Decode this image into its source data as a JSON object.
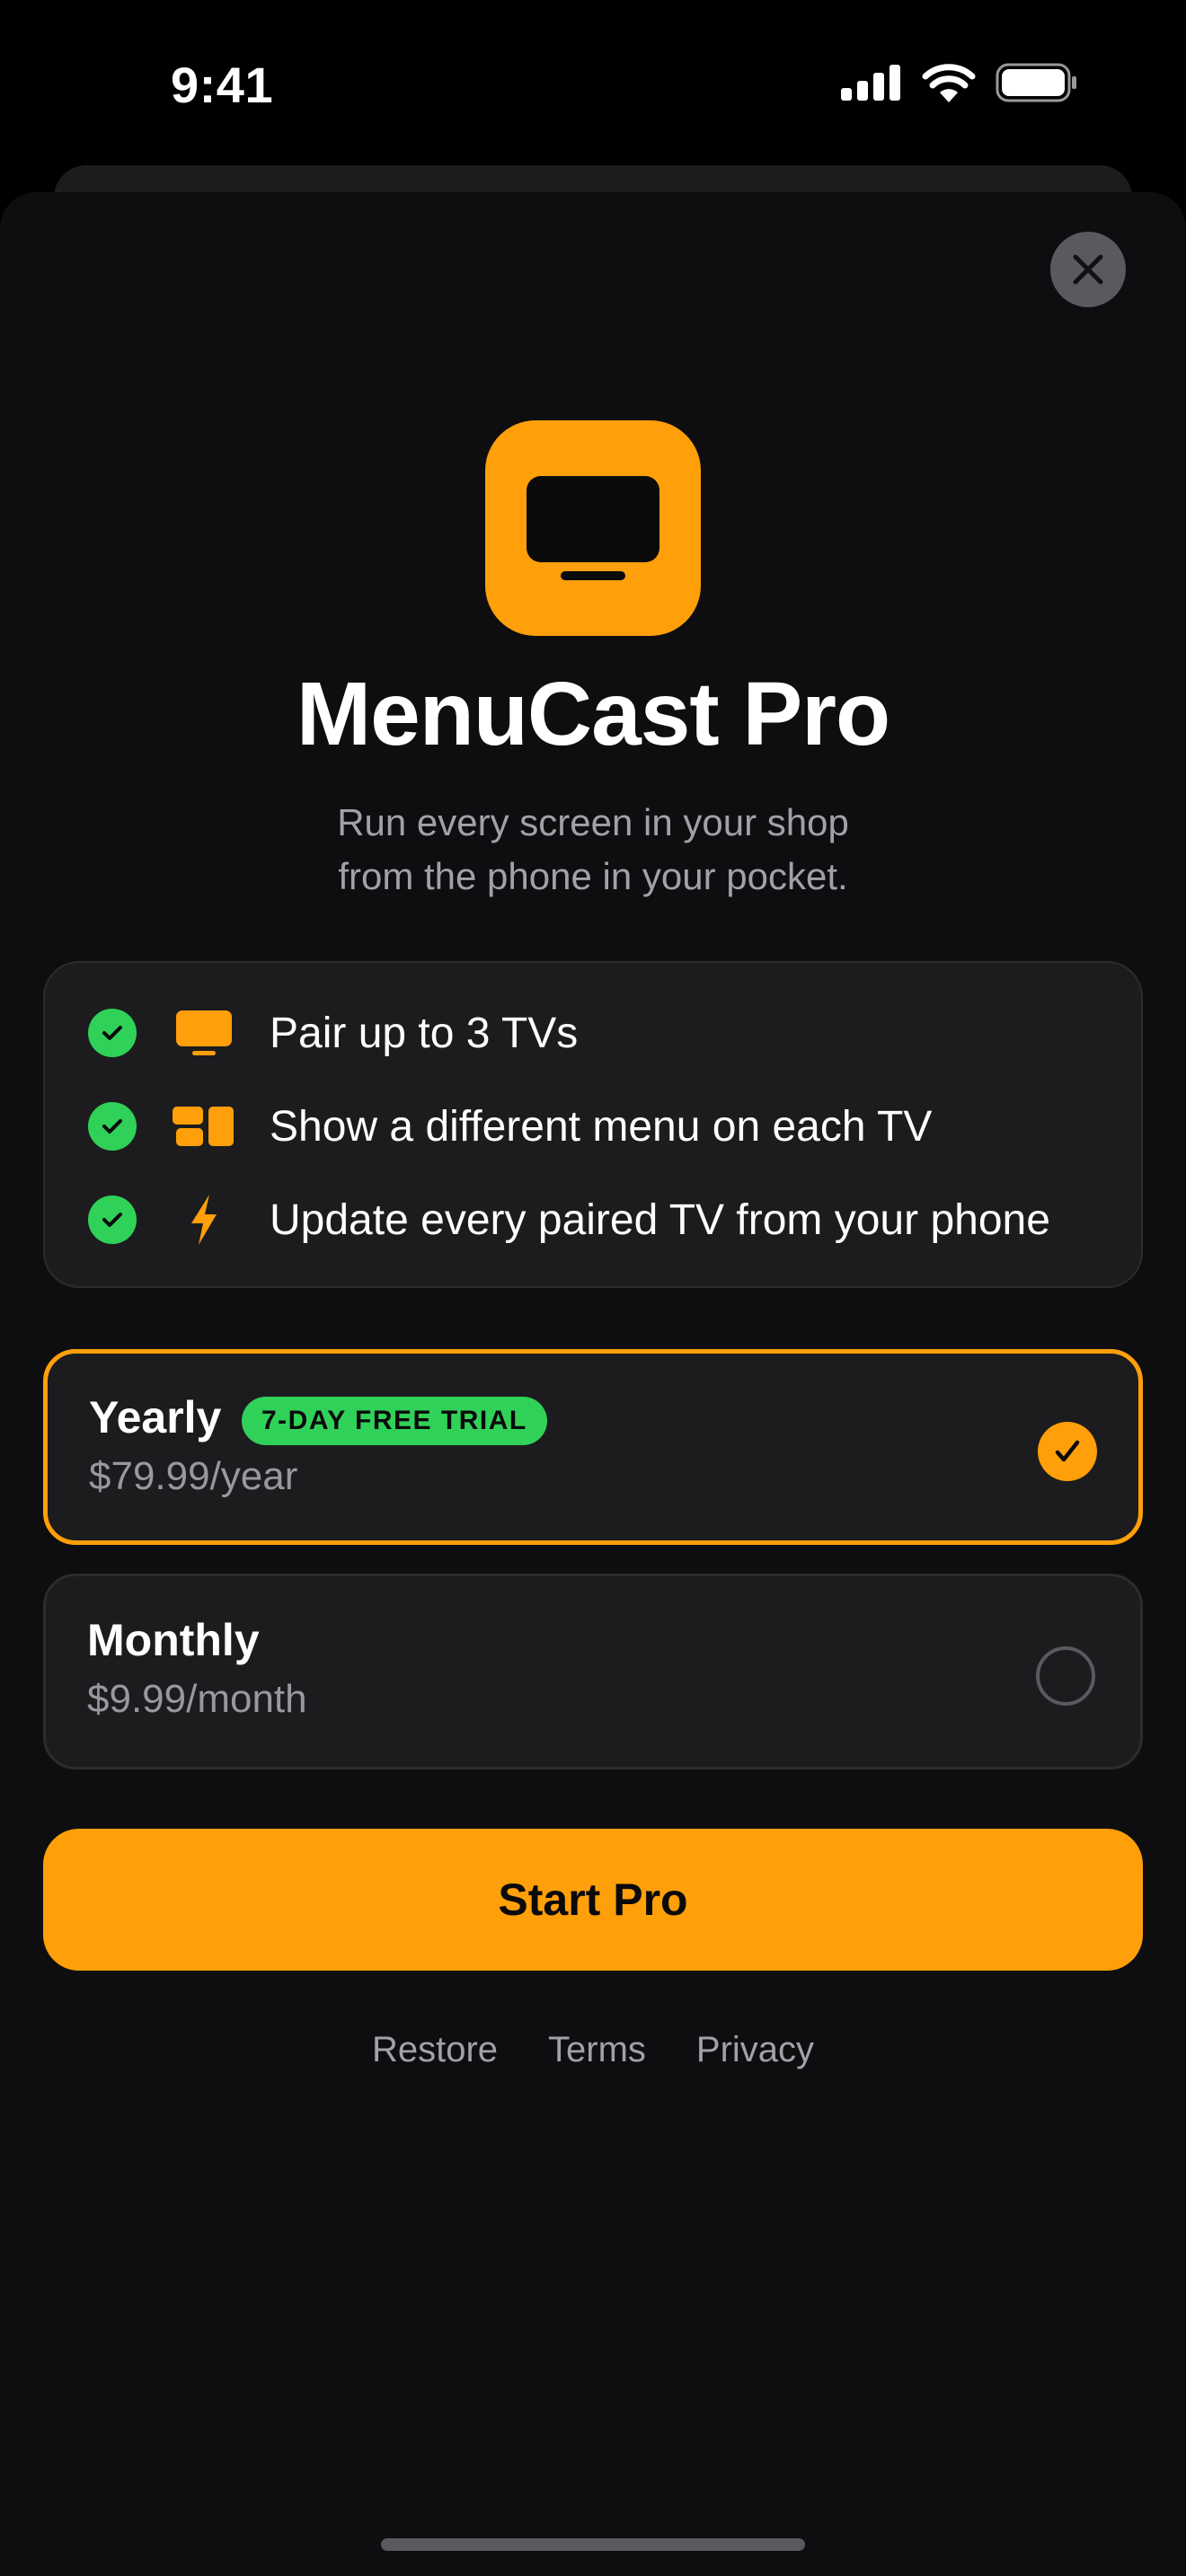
{
  "status_bar": {
    "time": "9:41",
    "icons": [
      "cellular-signal-icon",
      "wifi-icon",
      "battery-icon"
    ]
  },
  "header": {
    "close_icon": "close-icon"
  },
  "app": {
    "icon": "tv-app-icon",
    "title": "MenuCast Pro",
    "subtitle_line1": "Run every screen in your shop",
    "subtitle_line2": "from the phone in your pocket."
  },
  "features": [
    {
      "icon": "tv-icon",
      "text": "Pair up to 3 TVs"
    },
    {
      "icon": "layout-icon",
      "text": "Show a different menu on each TV"
    },
    {
      "icon": "bolt-icon",
      "text": "Update every paired TV from your phone"
    }
  ],
  "plans": [
    {
      "name": "Yearly",
      "badge": "7-DAY FREE TRIAL",
      "price": "$79.99/year",
      "selected": true
    },
    {
      "name": "Monthly",
      "price": "$9.99/month",
      "selected": false
    }
  ],
  "cta": {
    "label": "Start Pro"
  },
  "footer_links": [
    "Restore",
    "Terms",
    "Privacy"
  ],
  "colors": {
    "accent": "#ff9f0a",
    "success": "#30d158",
    "background": "#0e0e10",
    "card": "#1c1c1e"
  }
}
